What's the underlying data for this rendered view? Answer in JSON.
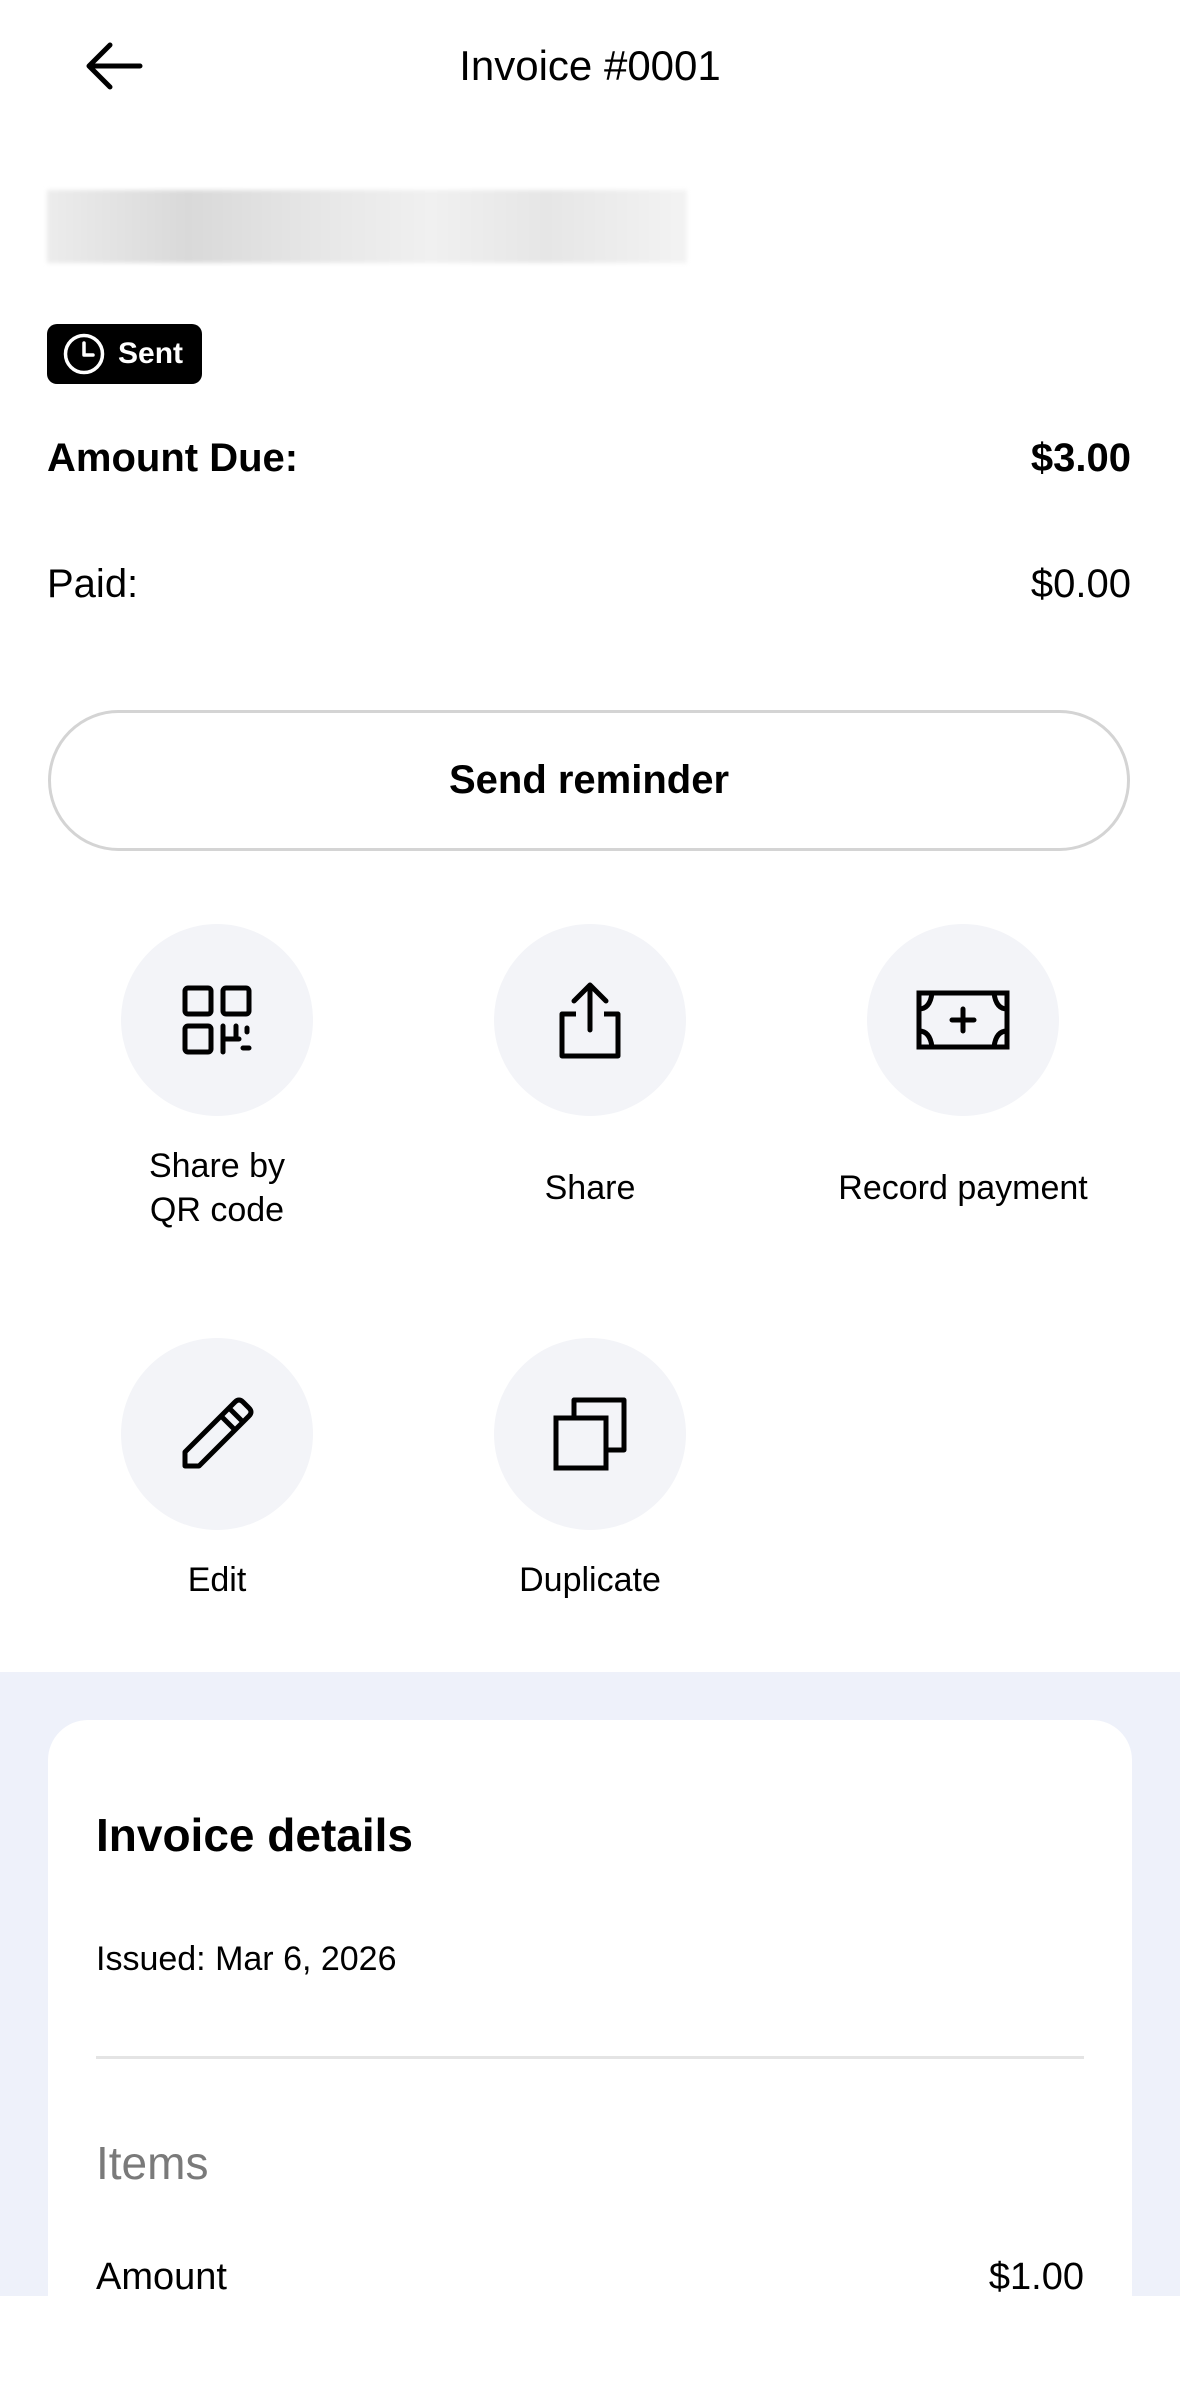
{
  "header": {
    "title": "Invoice #0001",
    "back_icon": "arrow-left-icon"
  },
  "status": {
    "label": "Sent",
    "icon": "clock-icon"
  },
  "summary": {
    "amount_due_label": "Amount Due:",
    "amount_due_value": "$3.00",
    "paid_label": "Paid:",
    "paid_value": "$0.00"
  },
  "reminder_button": {
    "label": "Send reminder"
  },
  "actions": [
    {
      "label_line1": "Share by",
      "label_line2": "QR code",
      "icon": "qr-code-icon"
    },
    {
      "label": "Share",
      "icon": "share-icon"
    },
    {
      "label": "Record payment",
      "icon": "cash-plus-icon"
    },
    {
      "label": "Edit",
      "icon": "pencil-icon"
    },
    {
      "label": "Duplicate",
      "icon": "duplicate-icon"
    }
  ],
  "details": {
    "title": "Invoice details",
    "issued": "Issued: Mar 6, 2026",
    "items_heading": "Items",
    "item_row": {
      "label": "Amount",
      "value": "$1.00"
    }
  },
  "colors": {
    "accent_black": "#000000",
    "action_circle": "#f3f4f8",
    "details_background": "#eef1fa",
    "button_border": "#d4d4d4",
    "muted_text": "#7a7a7a"
  }
}
